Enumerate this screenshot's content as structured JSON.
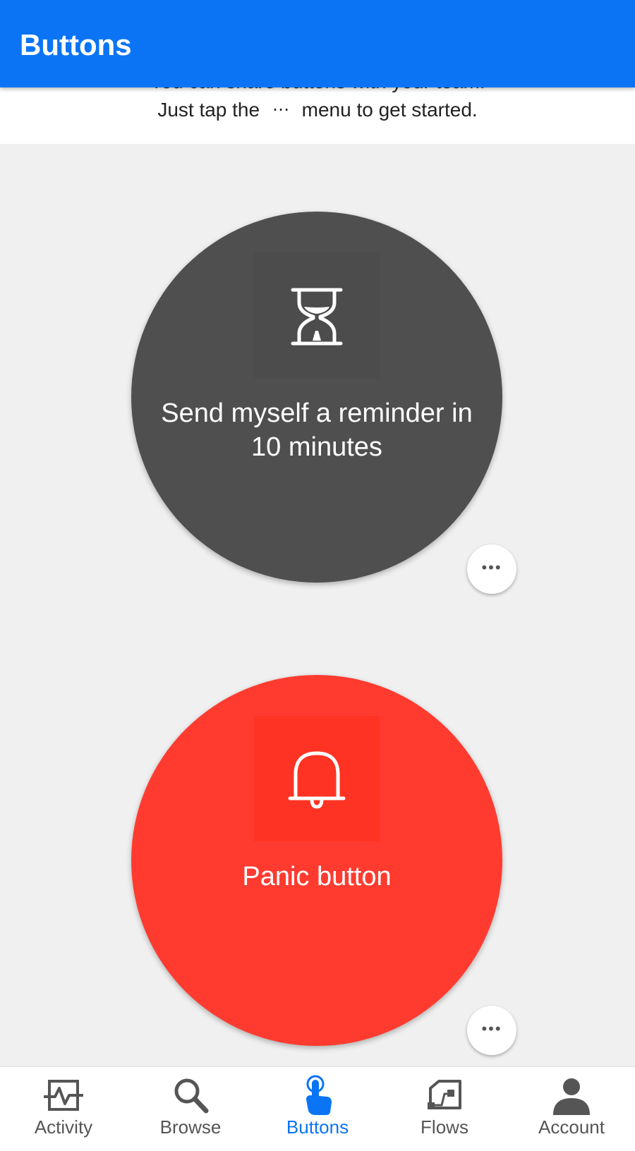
{
  "app_bar": {
    "title": "Buttons"
  },
  "info_banner": {
    "line1_partial": "You can share buttons with your team.",
    "line2_before": "Just tap the",
    "menu_glyph": "⋯",
    "line2_after": "menu to get started."
  },
  "buttons": [
    {
      "label": "Send myself a reminder in 10 minutes",
      "icon": "hourglass-icon",
      "color": "#4e4f4e",
      "more_glyph": "•••"
    },
    {
      "label": "Panic button",
      "icon": "bell-icon",
      "color": "#ff3b30",
      "more_glyph": "•••"
    }
  ],
  "bottom_nav": {
    "items": [
      {
        "label": "Activity",
        "icon": "activity-icon",
        "active": false
      },
      {
        "label": "Browse",
        "icon": "search-icon",
        "active": false
      },
      {
        "label": "Buttons",
        "icon": "tap-icon",
        "active": true
      },
      {
        "label": "Flows",
        "icon": "flows-icon",
        "active": false
      },
      {
        "label": "Account",
        "icon": "person-icon",
        "active": false
      }
    ]
  },
  "colors": {
    "accent": "#0a74f5",
    "background": "#f0f0f0",
    "nav_inactive": "#555555"
  }
}
